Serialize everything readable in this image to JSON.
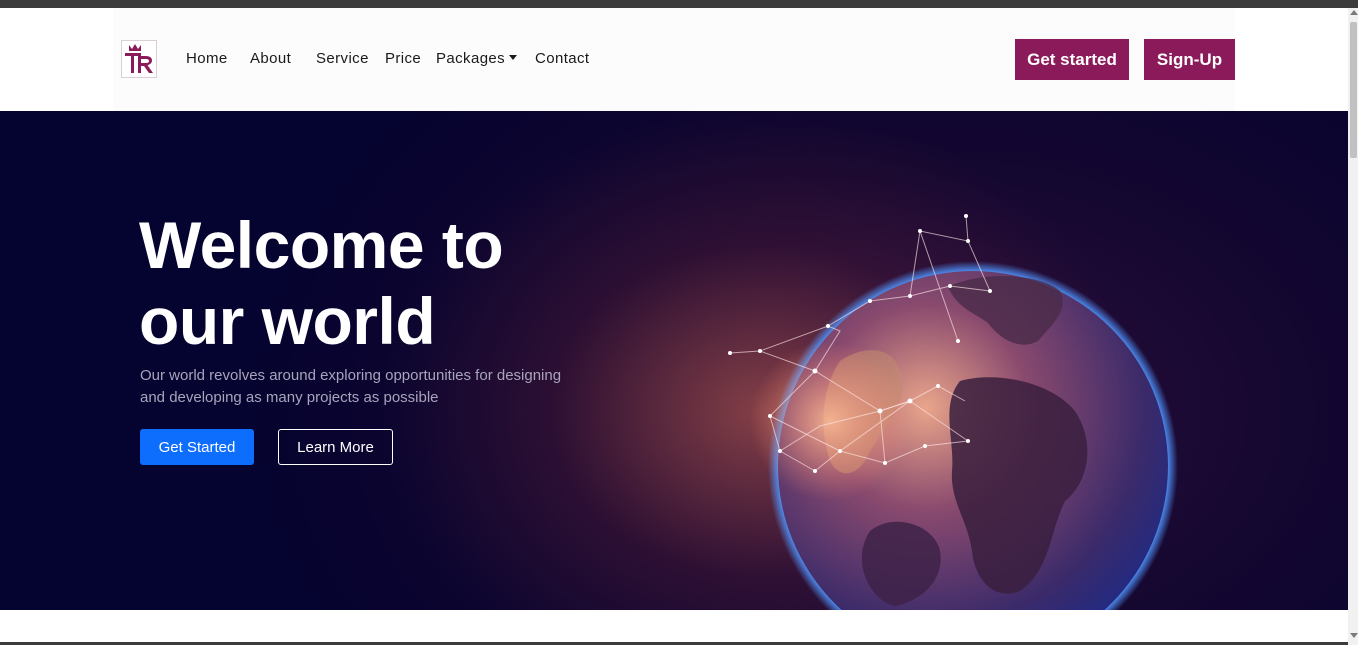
{
  "navbar": {
    "logo_alt": "TR",
    "links": [
      {
        "label": "Home"
      },
      {
        "label": "About"
      },
      {
        "label": "Service"
      },
      {
        "label": "Price"
      },
      {
        "label": "Packages"
      },
      {
        "label": "Contact"
      }
    ],
    "get_started_label": "Get started",
    "signup_label": "Sign-Up",
    "brand_color": "#8b1a5a"
  },
  "hero": {
    "title_line1": "Welcome to",
    "title_line2": "our world",
    "subtitle_line1": "Our world revolves around exploring opportunities for designing",
    "subtitle_line2": "and developing as many projects as possible",
    "primary_button": "Get Started",
    "secondary_button": "Learn More",
    "primary_color": "#0d6efd",
    "background_color": "#05032f",
    "image_icon": "globe-network-icon"
  }
}
